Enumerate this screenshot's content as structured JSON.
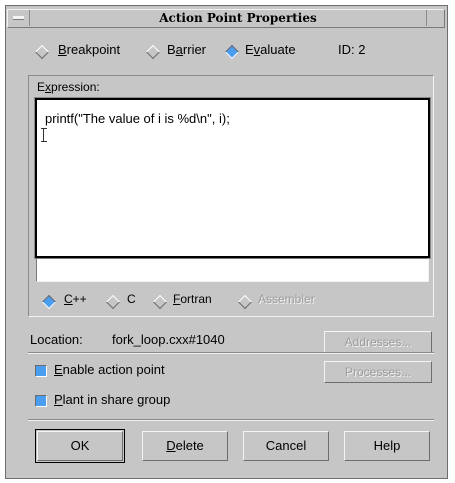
{
  "window": {
    "title": "Action Point Properties"
  },
  "type_radios": [
    {
      "label": "Breakpoint",
      "selected": false,
      "underline": "B"
    },
    {
      "label": "Barrier",
      "selected": false,
      "underline": "a"
    },
    {
      "label": "Evaluate",
      "selected": true,
      "underline": "v"
    }
  ],
  "id_label": "ID: 2",
  "expression": {
    "label": "Expression:",
    "value": "printf(\"The value of i is %d\\n\", i);",
    "secondary_value": ""
  },
  "language_radios": [
    {
      "label": "C++",
      "selected": true,
      "enabled": true
    },
    {
      "label": "C",
      "selected": false,
      "enabled": true
    },
    {
      "label": "Fortran",
      "selected": false,
      "enabled": true
    },
    {
      "label": "Assembler",
      "selected": false,
      "enabled": false
    }
  ],
  "location": {
    "label": "Location:",
    "value": "fork_loop.cxx#1040"
  },
  "addresses_button": "Addresses...",
  "processes_button": "Processes...",
  "checkboxes": [
    {
      "label": "Enable action point",
      "checked": true
    },
    {
      "label": "Plant in share group",
      "checked": true
    }
  ],
  "buttons": {
    "ok": "OK",
    "delete": "Delete",
    "cancel": "Cancel",
    "help": "Help"
  },
  "colors": {
    "face": "#c6c6c6",
    "accent": "#4a9ef0"
  }
}
